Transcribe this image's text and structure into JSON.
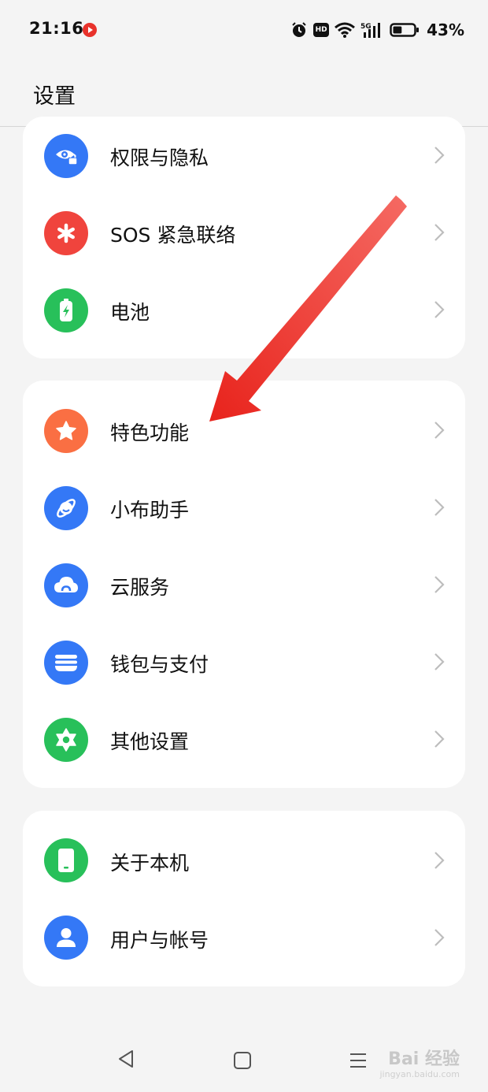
{
  "status_bar": {
    "time": "21:16",
    "hd": "HD",
    "battery_percent": "43%",
    "battery_level": 0.43
  },
  "header": {
    "title": "设置"
  },
  "groups": [
    {
      "items": [
        {
          "label": "权限与隐私",
          "icon": "privacy-eye-lock-icon",
          "color": "#3478f6"
        },
        {
          "label": "SOS 紧急联络",
          "icon": "sos-asterisk-icon",
          "color": "#f0443d"
        },
        {
          "label": "电池",
          "icon": "battery-bolt-icon",
          "color": "#28c05a"
        }
      ]
    },
    {
      "items": [
        {
          "label": "特色功能",
          "icon": "star-icon",
          "color": "#fa6f43"
        },
        {
          "label": "小布助手",
          "icon": "assistant-planet-icon",
          "color": "#3478f6"
        },
        {
          "label": "云服务",
          "icon": "cloud-icon",
          "color": "#3478f6"
        },
        {
          "label": "钱包与支付",
          "icon": "wallet-icon",
          "color": "#3478f6"
        },
        {
          "label": "其他设置",
          "icon": "gear-icon",
          "color": "#28c05a"
        }
      ]
    },
    {
      "items": [
        {
          "label": "关于本机",
          "icon": "phone-icon",
          "color": "#28c05a"
        },
        {
          "label": "用户与帐号",
          "icon": "user-icon",
          "color": "#3478f6"
        }
      ]
    }
  ],
  "annotation": {
    "arrow_color": "#e8231c"
  },
  "watermark": {
    "brand": "Bai  经验",
    "url": "jingyan.baidu.com"
  }
}
